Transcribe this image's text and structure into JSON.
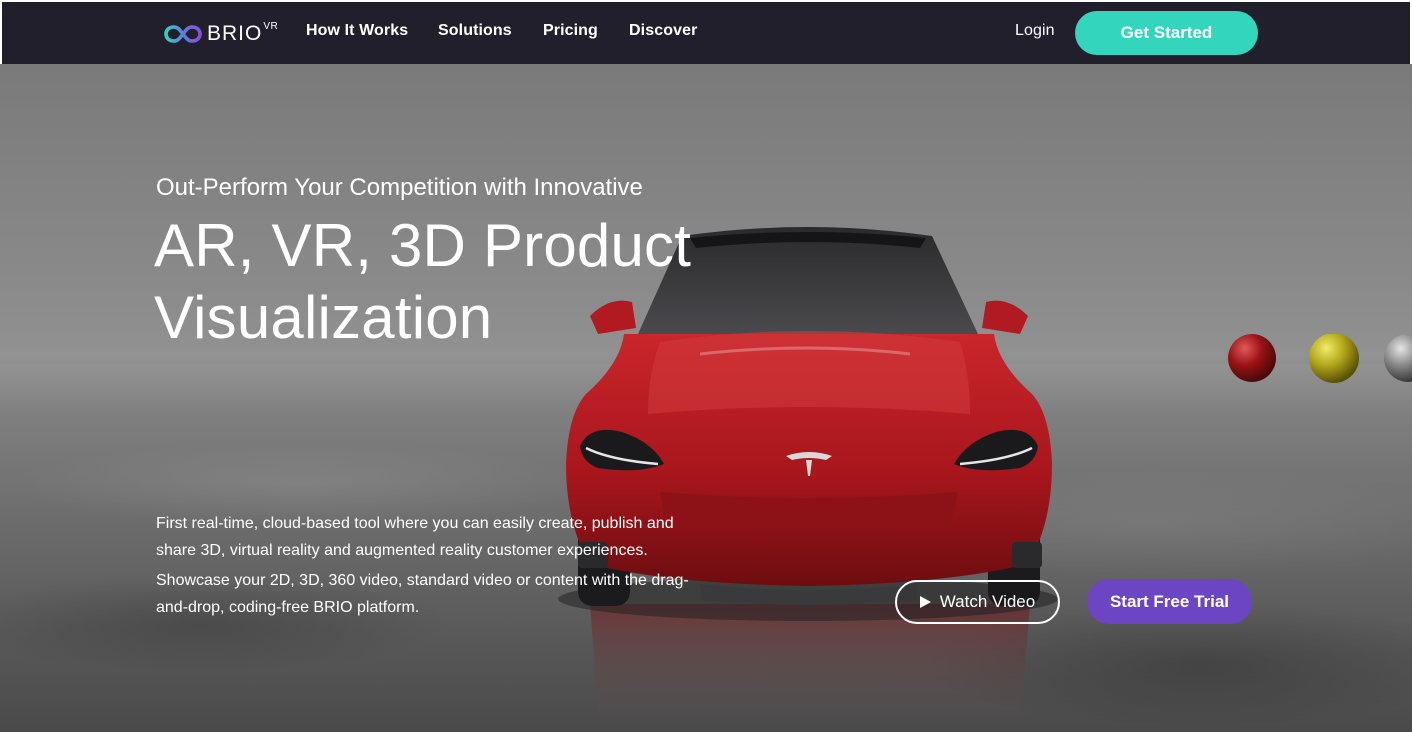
{
  "nav": {
    "logo_text": "BRIO",
    "logo_sup": "VR",
    "links": [
      "How It Works",
      "Solutions",
      "Pricing",
      "Discover"
    ],
    "login": "Login",
    "get_started": "Get Started"
  },
  "hero": {
    "eyebrow": "Out-Perform Your Competition with Innovative",
    "title_line1": "AR, VR, 3D Product",
    "title_line2": "Visualization",
    "desc1": "First real-time, cloud-based tool where you can easily create, publish and share 3D, virtual reality and augmented reality customer experiences.",
    "desc2": "Showcase your 2D, 3D, 360 video, standard video or content with the drag-and-drop, coding-free BRIO platform.",
    "watch_video": "Watch Video",
    "start_trial": "Start Free Trial"
  },
  "colors": {
    "nav_bg": "#221f2c",
    "accent_teal": "#34d5bd",
    "accent_purple": "#6c45c4",
    "car_red": "#b3191f"
  },
  "icons": {
    "logo": "infinity-logo-icon",
    "play": "play-icon"
  }
}
